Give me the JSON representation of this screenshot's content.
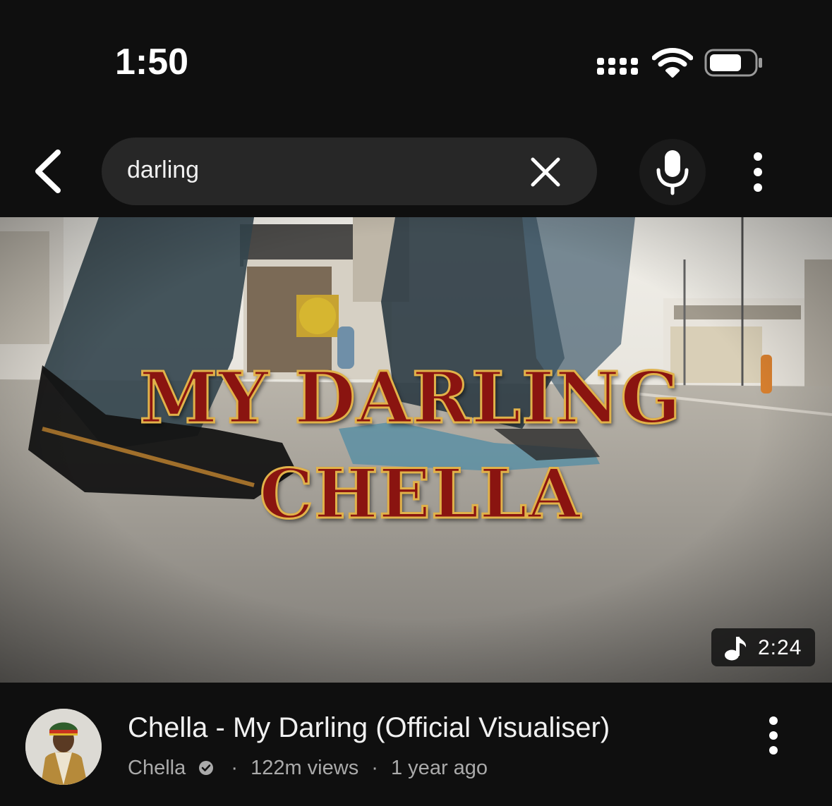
{
  "status_bar": {
    "time": "1:50"
  },
  "header": {
    "back_icon": "chevron-left-icon",
    "search": {
      "value": "darling",
      "clear_icon": "close-icon"
    },
    "mic_icon": "microphone-icon",
    "more_icon": "vertical-ellipsis-icon"
  },
  "video": {
    "thumbnail_title_line_1": "MY DARLING",
    "thumbnail_title_line_2": "CHELLA",
    "badge_icon": "music-note-icon",
    "duration": "2:24",
    "title": "Chella - My Darling (Official Visualiser)",
    "channel": "Chella",
    "verified_icon": "verified-badge-icon",
    "separator": "·",
    "views": "122m views",
    "age": "1 year ago",
    "more_icon": "vertical-ellipsis-icon"
  },
  "colors": {
    "background": "#0f0f0f",
    "search_box": "#272727",
    "primary_text": "#f1f1f1",
    "secondary_text": "#aaaaaa",
    "thumbnail_title_fill": "#8a1410",
    "thumbnail_title_outline": "#e1b24a"
  }
}
